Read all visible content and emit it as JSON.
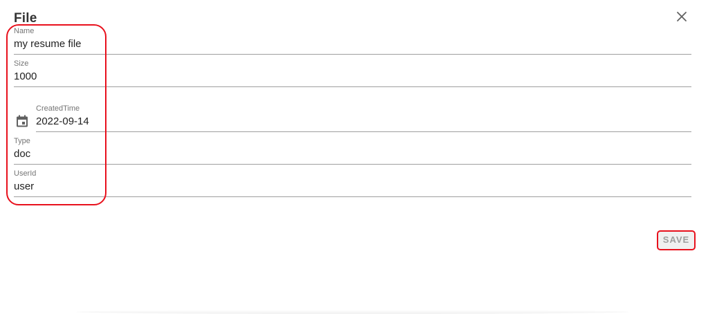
{
  "dialog": {
    "title": "File",
    "close_icon": "close-icon"
  },
  "fields": {
    "name": {
      "label": "Name",
      "value": "my resume file"
    },
    "size": {
      "label": "Size",
      "value": "1000"
    },
    "created_time": {
      "label": "CreatedTime",
      "value": "2022-09-14",
      "icon": "calendar-icon"
    },
    "type": {
      "label": "Type",
      "value": "doc"
    },
    "user_id": {
      "label": "UserId",
      "value": "user"
    }
  },
  "actions": {
    "save_label": "SAVE"
  },
  "colors": {
    "annotation_red": "#e8101c",
    "underline": "#9e9e9e",
    "label": "#757575",
    "disabled_text": "#9e9e9e"
  }
}
